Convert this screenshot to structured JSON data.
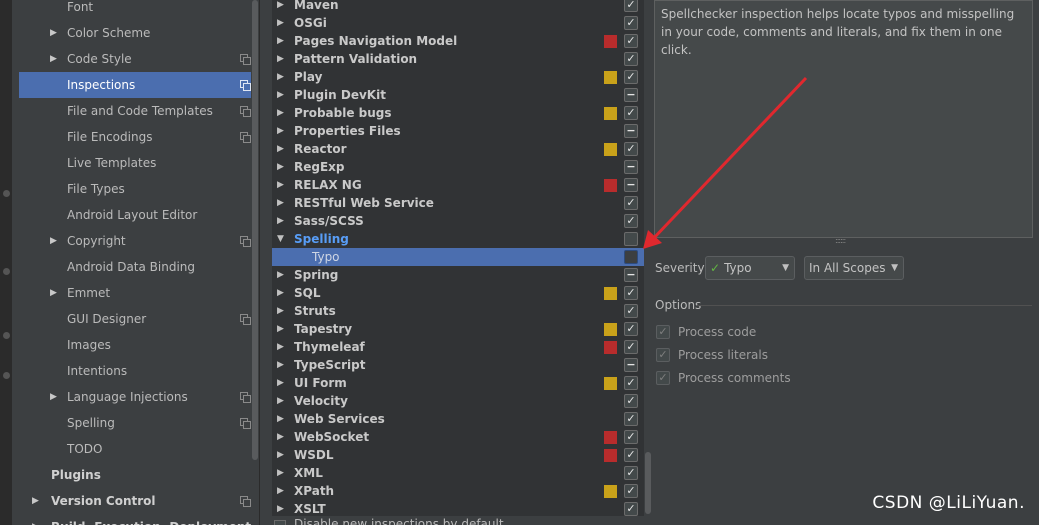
{
  "settings_tree": {
    "items": [
      {
        "label": "Font",
        "level": "child",
        "expandable": false,
        "copy_icon": false
      },
      {
        "label": "Color Scheme",
        "level": "child",
        "expandable": true,
        "copy_icon": false
      },
      {
        "label": "Code Style",
        "level": "child",
        "expandable": true,
        "copy_icon": true
      },
      {
        "label": "Inspections",
        "level": "child",
        "expandable": false,
        "copy_icon": true,
        "selected": true
      },
      {
        "label": "File and Code Templates",
        "level": "child",
        "expandable": false,
        "copy_icon": true
      },
      {
        "label": "File Encodings",
        "level": "child",
        "expandable": false,
        "copy_icon": true
      },
      {
        "label": "Live Templates",
        "level": "child",
        "expandable": false,
        "copy_icon": false
      },
      {
        "label": "File Types",
        "level": "child",
        "expandable": false,
        "copy_icon": false
      },
      {
        "label": "Android Layout Editor",
        "level": "child",
        "expandable": false,
        "copy_icon": false
      },
      {
        "label": "Copyright",
        "level": "child",
        "expandable": true,
        "copy_icon": true
      },
      {
        "label": "Android Data Binding",
        "level": "child",
        "expandable": false,
        "copy_icon": false
      },
      {
        "label": "Emmet",
        "level": "child",
        "expandable": true,
        "copy_icon": false
      },
      {
        "label": "GUI Designer",
        "level": "child",
        "expandable": false,
        "copy_icon": true
      },
      {
        "label": "Images",
        "level": "child",
        "expandable": false,
        "copy_icon": false
      },
      {
        "label": "Intentions",
        "level": "child",
        "expandable": false,
        "copy_icon": false
      },
      {
        "label": "Language Injections",
        "level": "child",
        "expandable": true,
        "copy_icon": true
      },
      {
        "label": "Spelling",
        "level": "child",
        "expandable": false,
        "copy_icon": true
      },
      {
        "label": "TODO",
        "level": "child",
        "expandable": false,
        "copy_icon": false
      },
      {
        "label": "Plugins",
        "level": "top",
        "expandable": false,
        "copy_icon": false
      },
      {
        "label": "Version Control",
        "level": "top",
        "expandable": true,
        "copy_icon": true
      },
      {
        "label": "Build, Execution, Deployment",
        "level": "top",
        "expandable": true,
        "copy_icon": false
      }
    ]
  },
  "inspections": {
    "rows": [
      {
        "label": "Maven",
        "sev": "",
        "check": "checked"
      },
      {
        "label": "OSGi",
        "sev": "",
        "check": "checked"
      },
      {
        "label": "Pages Navigation Model",
        "sev": "error",
        "check": "checked"
      },
      {
        "label": "Pattern Validation",
        "sev": "",
        "check": "checked"
      },
      {
        "label": "Play",
        "sev": "warning",
        "check": "checked"
      },
      {
        "label": "Plugin DevKit",
        "sev": "",
        "check": "mixed"
      },
      {
        "label": "Probable bugs",
        "sev": "warning",
        "check": "checked"
      },
      {
        "label": "Properties Files",
        "sev": "",
        "check": "mixed"
      },
      {
        "label": "Reactor",
        "sev": "warning",
        "check": "checked"
      },
      {
        "label": "RegExp",
        "sev": "",
        "check": "mixed"
      },
      {
        "label": "RELAX NG",
        "sev": "error",
        "check": "mixed"
      },
      {
        "label": "RESTful Web Service",
        "sev": "",
        "check": "checked"
      },
      {
        "label": "Sass/SCSS",
        "sev": "",
        "check": "checked"
      },
      {
        "label": "Spelling",
        "sev": "",
        "check": "unchecked",
        "expanded": true
      },
      {
        "label": "Typo",
        "sev": "",
        "check": "unchecked",
        "child": true,
        "selected": true
      },
      {
        "label": "Spring",
        "sev": "",
        "check": "mixed"
      },
      {
        "label": "SQL",
        "sev": "warning",
        "check": "checked"
      },
      {
        "label": "Struts",
        "sev": "",
        "check": "checked"
      },
      {
        "label": "Tapestry",
        "sev": "warning",
        "check": "checked"
      },
      {
        "label": "Thymeleaf",
        "sev": "error",
        "check": "checked"
      },
      {
        "label": "TypeScript",
        "sev": "",
        "check": "mixed"
      },
      {
        "label": "UI Form",
        "sev": "warning",
        "check": "checked"
      },
      {
        "label": "Velocity",
        "sev": "",
        "check": "checked"
      },
      {
        "label": "Web Services",
        "sev": "",
        "check": "checked"
      },
      {
        "label": "WebSocket",
        "sev": "error",
        "check": "checked"
      },
      {
        "label": "WSDL",
        "sev": "error",
        "check": "checked"
      },
      {
        "label": "XML",
        "sev": "",
        "check": "checked"
      },
      {
        "label": "XPath",
        "sev": "warning",
        "check": "checked"
      },
      {
        "label": "XSLT",
        "sev": "",
        "check": "checked"
      }
    ],
    "disable_new_label": "Disable new inspections by default"
  },
  "details": {
    "description": "Spellchecker inspection helps locate typos and misspelling in your code, comments and literals, and fix them in one click.",
    "severity_label": "Severity:",
    "severity_value": "Typo",
    "scope_value": "In All Scopes",
    "options_label": "Options",
    "options": [
      {
        "label": "Process code",
        "checked": true
      },
      {
        "label": "Process literals",
        "checked": true
      },
      {
        "label": "Process comments",
        "checked": true
      }
    ]
  },
  "watermark": "CSDN @LiLiYuan.",
  "colors": {
    "selection": "#4b6eaf",
    "sev_error": "#b82c2c",
    "sev_warning": "#c9a21a",
    "annotation_arrow": "#e0282e"
  },
  "icons": {
    "expand": "▶",
    "collapse": "▼",
    "check": "✓",
    "mixed": "−",
    "typo": "✓"
  }
}
